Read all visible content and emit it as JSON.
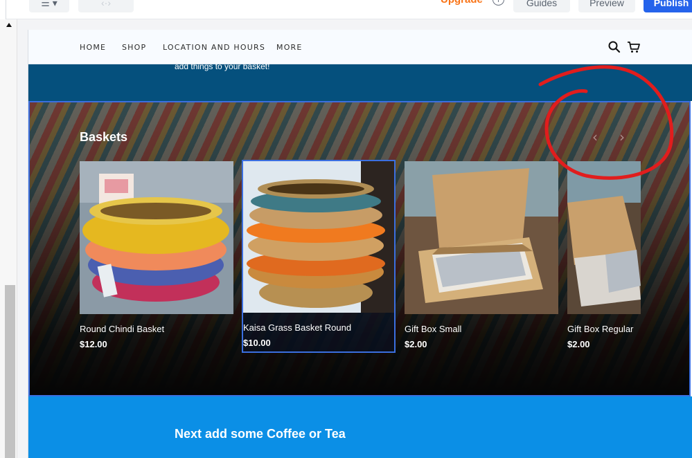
{
  "editor": {
    "upgrade_label": "Upgrade",
    "info_label": "i",
    "guides_label": "Guides",
    "preview_label": "Preview",
    "publish_label": "Publish",
    "undo_icon": "undo-icon",
    "redo_icon": "redo-icon",
    "menu_icon": "menu-icon"
  },
  "nav": {
    "items": [
      "HOME",
      "SHOP",
      "LOCATION AND HOURS",
      "MORE"
    ],
    "search_icon": "search-icon",
    "cart_icon": "cart-icon"
  },
  "hero": {
    "text": "add things to your basket!"
  },
  "baskets": {
    "title": "Baskets",
    "prev_arrow": "‹",
    "next_arrow": "›",
    "products": [
      {
        "name": "Round Chindi Basket",
        "price": "$12.00"
      },
      {
        "name": "Kaisa Grass Basket Round",
        "price": "$10.00"
      },
      {
        "name": "Gift Box Small",
        "price": "$2.00"
      },
      {
        "name": "Gift Box Regular",
        "price": "$2.00"
      }
    ]
  },
  "next_section": {
    "title": "Next add some Coffee or Tea"
  },
  "colors": {
    "accent": "#2563eb",
    "upgrade": "#f97316",
    "hero_bg": "#05507d",
    "next_bg": "#0b8fe6",
    "selection": "#3b6fe0",
    "annotation": "#e11d1d"
  }
}
